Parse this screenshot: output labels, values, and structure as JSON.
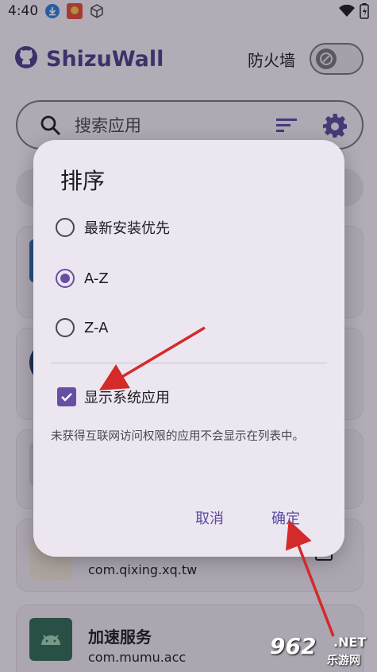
{
  "status_bar": {
    "time": "4:40",
    "icons": [
      "download-icon",
      "app-notification-icon",
      "cube-icon",
      "wifi-icon",
      "battery-icon"
    ]
  },
  "header": {
    "app_name": "ShizuWall",
    "firewall_label": "防火墙",
    "firewall_enabled": false,
    "logo_icon": "github-icon"
  },
  "search": {
    "placeholder": "搜索应用",
    "value": ""
  },
  "app_list": [
    {
      "name": "",
      "package": ""
    },
    {
      "name": "",
      "package": ""
    },
    {
      "name": "",
      "package": ""
    },
    {
      "name": "",
      "package": "com.qixing.xq.tw"
    },
    {
      "name": "加速服务",
      "package": "com.mumu.acc"
    }
  ],
  "sort_dialog": {
    "title": "排序",
    "options": [
      {
        "label": "最新安装优先",
        "selected": false
      },
      {
        "label": "A-Z",
        "selected": true
      },
      {
        "label": "Z-A",
        "selected": false
      }
    ],
    "show_system_apps_label": "显示系统应用",
    "show_system_apps_checked": true,
    "hint": "未获得互联网访问权限的应用不会显示在列表中。",
    "cancel_label": "取消",
    "confirm_label": "确定"
  },
  "watermark": {
    "number": "962",
    "net": ".NET",
    "site": "乐游网"
  },
  "colors": {
    "accent": "#6750a4",
    "title": "#4a3e8c",
    "annotation_arrow": "#d42a2a"
  }
}
